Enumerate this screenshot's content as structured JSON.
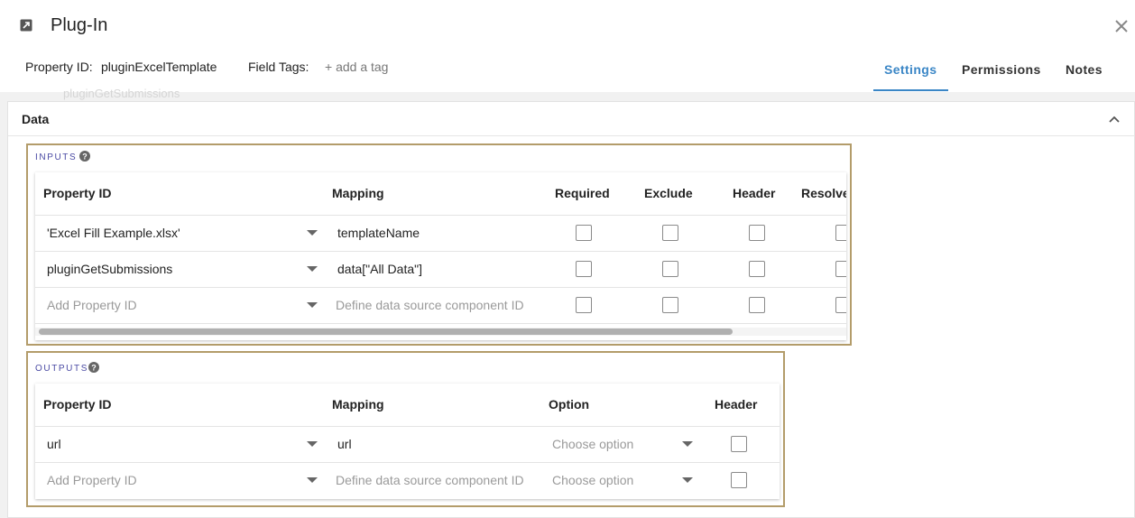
{
  "header": {
    "title": "Plug-In",
    "property_id_label": "Property ID:",
    "property_id_value": "pluginExcelTemplate",
    "field_tags_label": "Field Tags:",
    "add_tag_label": "+ add a tag",
    "tabs": [
      {
        "label": "Settings",
        "active": true
      },
      {
        "label": "Permissions",
        "active": false
      },
      {
        "label": "Notes",
        "active": false
      }
    ],
    "accent_color": "#3a86c6"
  },
  "ghost_text": "pluginGetSubmissions",
  "panel": {
    "title": "Data"
  },
  "inputs": {
    "label": "INPUTS",
    "columns": [
      "Property ID",
      "Mapping",
      "Required",
      "Exclude",
      "Header",
      "Resolve"
    ],
    "rows": [
      {
        "property_id": "'Excel Fill Example.xlsx'",
        "mapping": "templateName"
      },
      {
        "property_id": "pluginGetSubmissions",
        "mapping": "data[\"All Data\"]"
      },
      {
        "property_id": "Add Property ID",
        "mapping": "Define data source component ID"
      }
    ]
  },
  "outputs": {
    "label": "OUTPUTS",
    "columns": [
      "Property ID",
      "Mapping",
      "Option",
      "Header"
    ],
    "rows": [
      {
        "property_id": "url",
        "mapping": "url",
        "option": "Choose option"
      },
      {
        "property_id": "Add Property ID",
        "mapping": "Define data source component ID",
        "option": "Choose option"
      }
    ]
  },
  "section_border_color": "#b39c6a",
  "section_label_color": "#4a4aa3"
}
